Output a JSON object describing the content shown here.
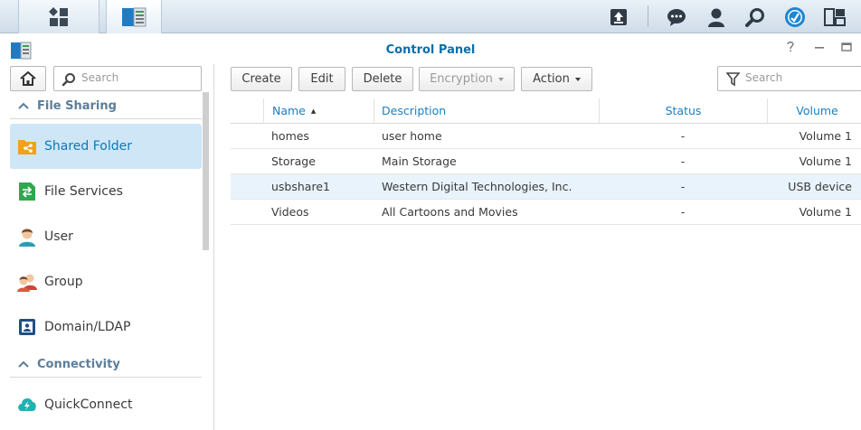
{
  "window": {
    "title": "Control Panel"
  },
  "sidebar": {
    "search_placeholder": "Search",
    "sections": [
      {
        "label": "File Sharing"
      },
      {
        "label": "Connectivity"
      }
    ],
    "items": [
      {
        "label": "Shared Folder",
        "icon": "shared-folder-icon"
      },
      {
        "label": "File Services",
        "icon": "file-services-icon"
      },
      {
        "label": "User",
        "icon": "user-icon"
      },
      {
        "label": "Group",
        "icon": "group-icon"
      },
      {
        "label": "Domain/LDAP",
        "icon": "domain-ldap-icon"
      },
      {
        "label": "QuickConnect",
        "icon": "quickconnect-icon"
      }
    ]
  },
  "toolbar": {
    "create": "Create",
    "edit": "Edit",
    "delete": "Delete",
    "encryption": "Encryption",
    "action": "Action",
    "search_placeholder": "Search"
  },
  "table": {
    "columns": [
      "Name",
      "Description",
      "Status",
      "Volume"
    ],
    "sort_indicator": "▲",
    "rows": [
      {
        "name": "homes",
        "description": "user home",
        "status": "-",
        "volume": "Volume 1"
      },
      {
        "name": "Storage",
        "description": "Main Storage",
        "status": "-",
        "volume": "Volume 1"
      },
      {
        "name": "usbshare1",
        "description": "Western Digital Technologies, Inc.",
        "status": "-",
        "volume": "USB device"
      },
      {
        "name": "Videos",
        "description": "All Cartoons and Movies",
        "status": "-",
        "volume": "Volume 1"
      }
    ]
  },
  "colors": {
    "accent": "#0b6ea8",
    "selection": "#cfe6f7",
    "section": "#5c7d99"
  }
}
